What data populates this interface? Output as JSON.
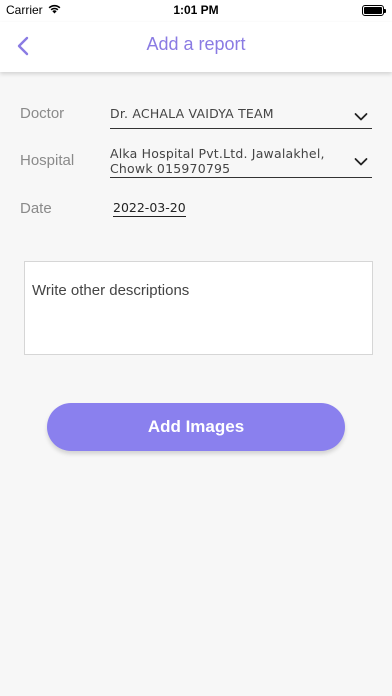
{
  "status_bar": {
    "carrier": "Carrier",
    "time": "1:01 PM",
    "icons": [
      "wifi-icon",
      "battery-icon"
    ]
  },
  "nav": {
    "title": "Add a report",
    "back_icon": "chevron-left-icon",
    "accent_color": "#8a7be3"
  },
  "form": {
    "doctor": {
      "label": "Doctor",
      "value": "Dr. ACHALA VAIDYA TEAM"
    },
    "hospital": {
      "label": "Hospital",
      "value": "Alka Hospital Pvt.Ltd. Jawalakhel, Chowk 015970795"
    },
    "date": {
      "label": "Date",
      "value": "2022-03-20"
    },
    "description": {
      "placeholder": "Write other descriptions",
      "value": ""
    },
    "add_images_label": "Add Images",
    "button_color": "#8a80ee"
  }
}
